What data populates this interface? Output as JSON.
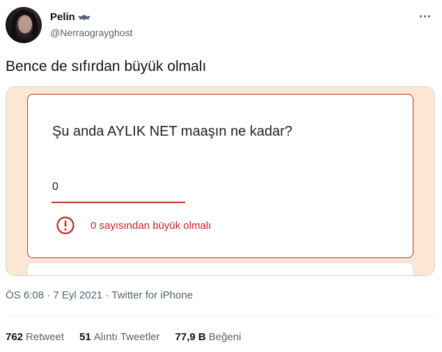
{
  "author": {
    "name": "Pelin",
    "handle": "@Nerraograyghost",
    "badge_icon": "bat-icon"
  },
  "tweet": {
    "text": "Bence de sıfırdan büyük olmalı"
  },
  "form": {
    "question": "Şu anda AYLIK NET maaşın ne kadar?",
    "answer_value": "0",
    "error_text": "0 sayısından büyük olmalı",
    "error_icon": "error-icon",
    "error_color": "#c5221f",
    "background_color": "#fbe7d4"
  },
  "meta": {
    "time": "ÖS 6:08",
    "date": "7 Eyl 2021",
    "source": "Twitter for iPhone"
  },
  "stats": [
    {
      "count": "762",
      "label": "Retweet"
    },
    {
      "count": "51",
      "label": "Alıntı Tweetler"
    },
    {
      "count": "77,9 B",
      "label": "Beğeni"
    }
  ]
}
